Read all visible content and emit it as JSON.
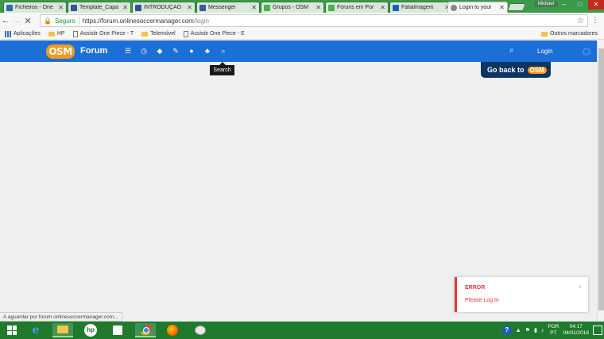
{
  "browser": {
    "tabs": [
      {
        "title": "Ficheiros - One",
        "color": "#2b6cb0"
      },
      {
        "title": "Template_Capa",
        "color": "#2b579a"
      },
      {
        "title": "INTRODUÇÃO",
        "color": "#2b579a"
      },
      {
        "title": "Messenger",
        "color": "#3b5998"
      },
      {
        "title": "Grupos - OSM",
        "color": "#4caf50"
      },
      {
        "title": "Fóruns em Por",
        "color": "#4caf50"
      },
      {
        "title": "Fatialmagem",
        "color": "#1565c0"
      },
      {
        "title": "Login to your",
        "color": "#888888"
      }
    ],
    "user_chip": "Mickael",
    "window_buttons": {
      "minimize": "–",
      "maximize": "□",
      "close": "✕"
    },
    "security_label": "Seguro",
    "url_host": "https://forum.onlinesoccermanager.com",
    "url_path": "/login",
    "bookmarks": [
      {
        "label": "Aplicações",
        "icon": "apps-grid-icon"
      },
      {
        "label": "HP",
        "icon": "folder-icon"
      },
      {
        "label": "Assistir One Piece - T",
        "icon": "page-icon"
      },
      {
        "label": "Telemóvel",
        "icon": "folder-icon"
      },
      {
        "label": "Assistir One Piece - E",
        "icon": "page-icon"
      }
    ],
    "other_bookmarks": "Outros marcadores",
    "status_text": "A aguardar por forum.onlinesoccermanager.com..."
  },
  "site": {
    "logo": "OSM",
    "title": "Forum",
    "nav_icons": [
      "list-icon",
      "clock-icon",
      "tags-icon",
      "pin-icon",
      "user-icon",
      "groups-icon",
      "search-icon"
    ],
    "tooltip": "Search",
    "login_label": "Login",
    "go_back_label": "Go back to",
    "go_back_logo": "OSM",
    "brand_color": "#1b6fd6"
  },
  "toast": {
    "title": "ERROR",
    "message": "Please Log In",
    "close": "×",
    "color": "#e03a3a"
  },
  "taskbar": {
    "language": "POR",
    "layout": "PT",
    "time": "04:17",
    "date": "04/01/2018"
  }
}
